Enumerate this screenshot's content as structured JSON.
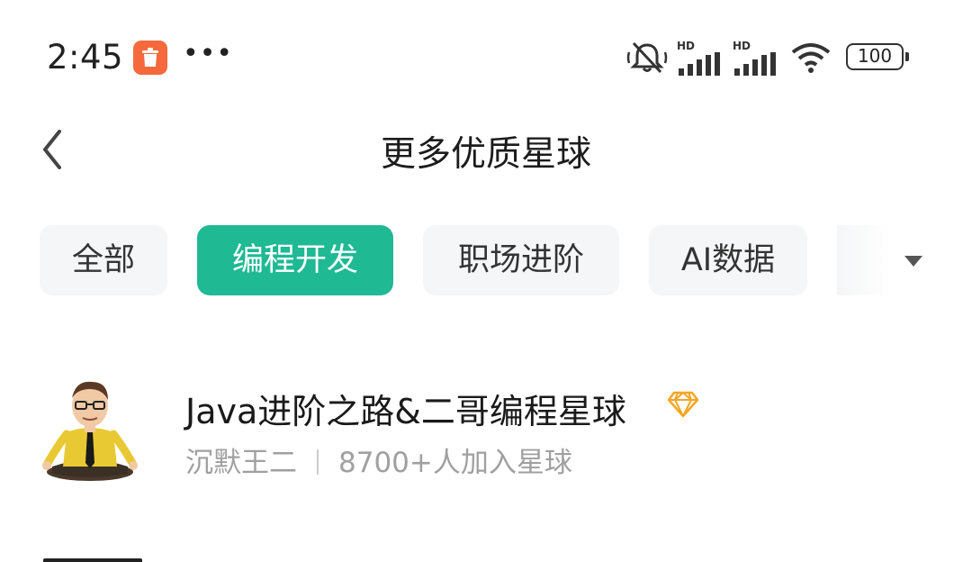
{
  "status_bar": {
    "time": "2:45",
    "battery": "100",
    "signal_labels": [
      "HD",
      "HD"
    ]
  },
  "header": {
    "title": "更多优质星球"
  },
  "tabs": [
    {
      "label": "全部",
      "active": false
    },
    {
      "label": "编程开发",
      "active": true
    },
    {
      "label": "职场进阶",
      "active": false
    },
    {
      "label": "AI数据",
      "active": false
    }
  ],
  "items": [
    {
      "title": "Java进阶之路&二哥编程星球",
      "owner": "沉默王二",
      "members": "8700+人加入星球",
      "badge_icon": "diamond-icon"
    }
  ],
  "colors": {
    "accent": "#1fb994",
    "app_badge": "#f5693c",
    "diamond": "#f5a623"
  }
}
